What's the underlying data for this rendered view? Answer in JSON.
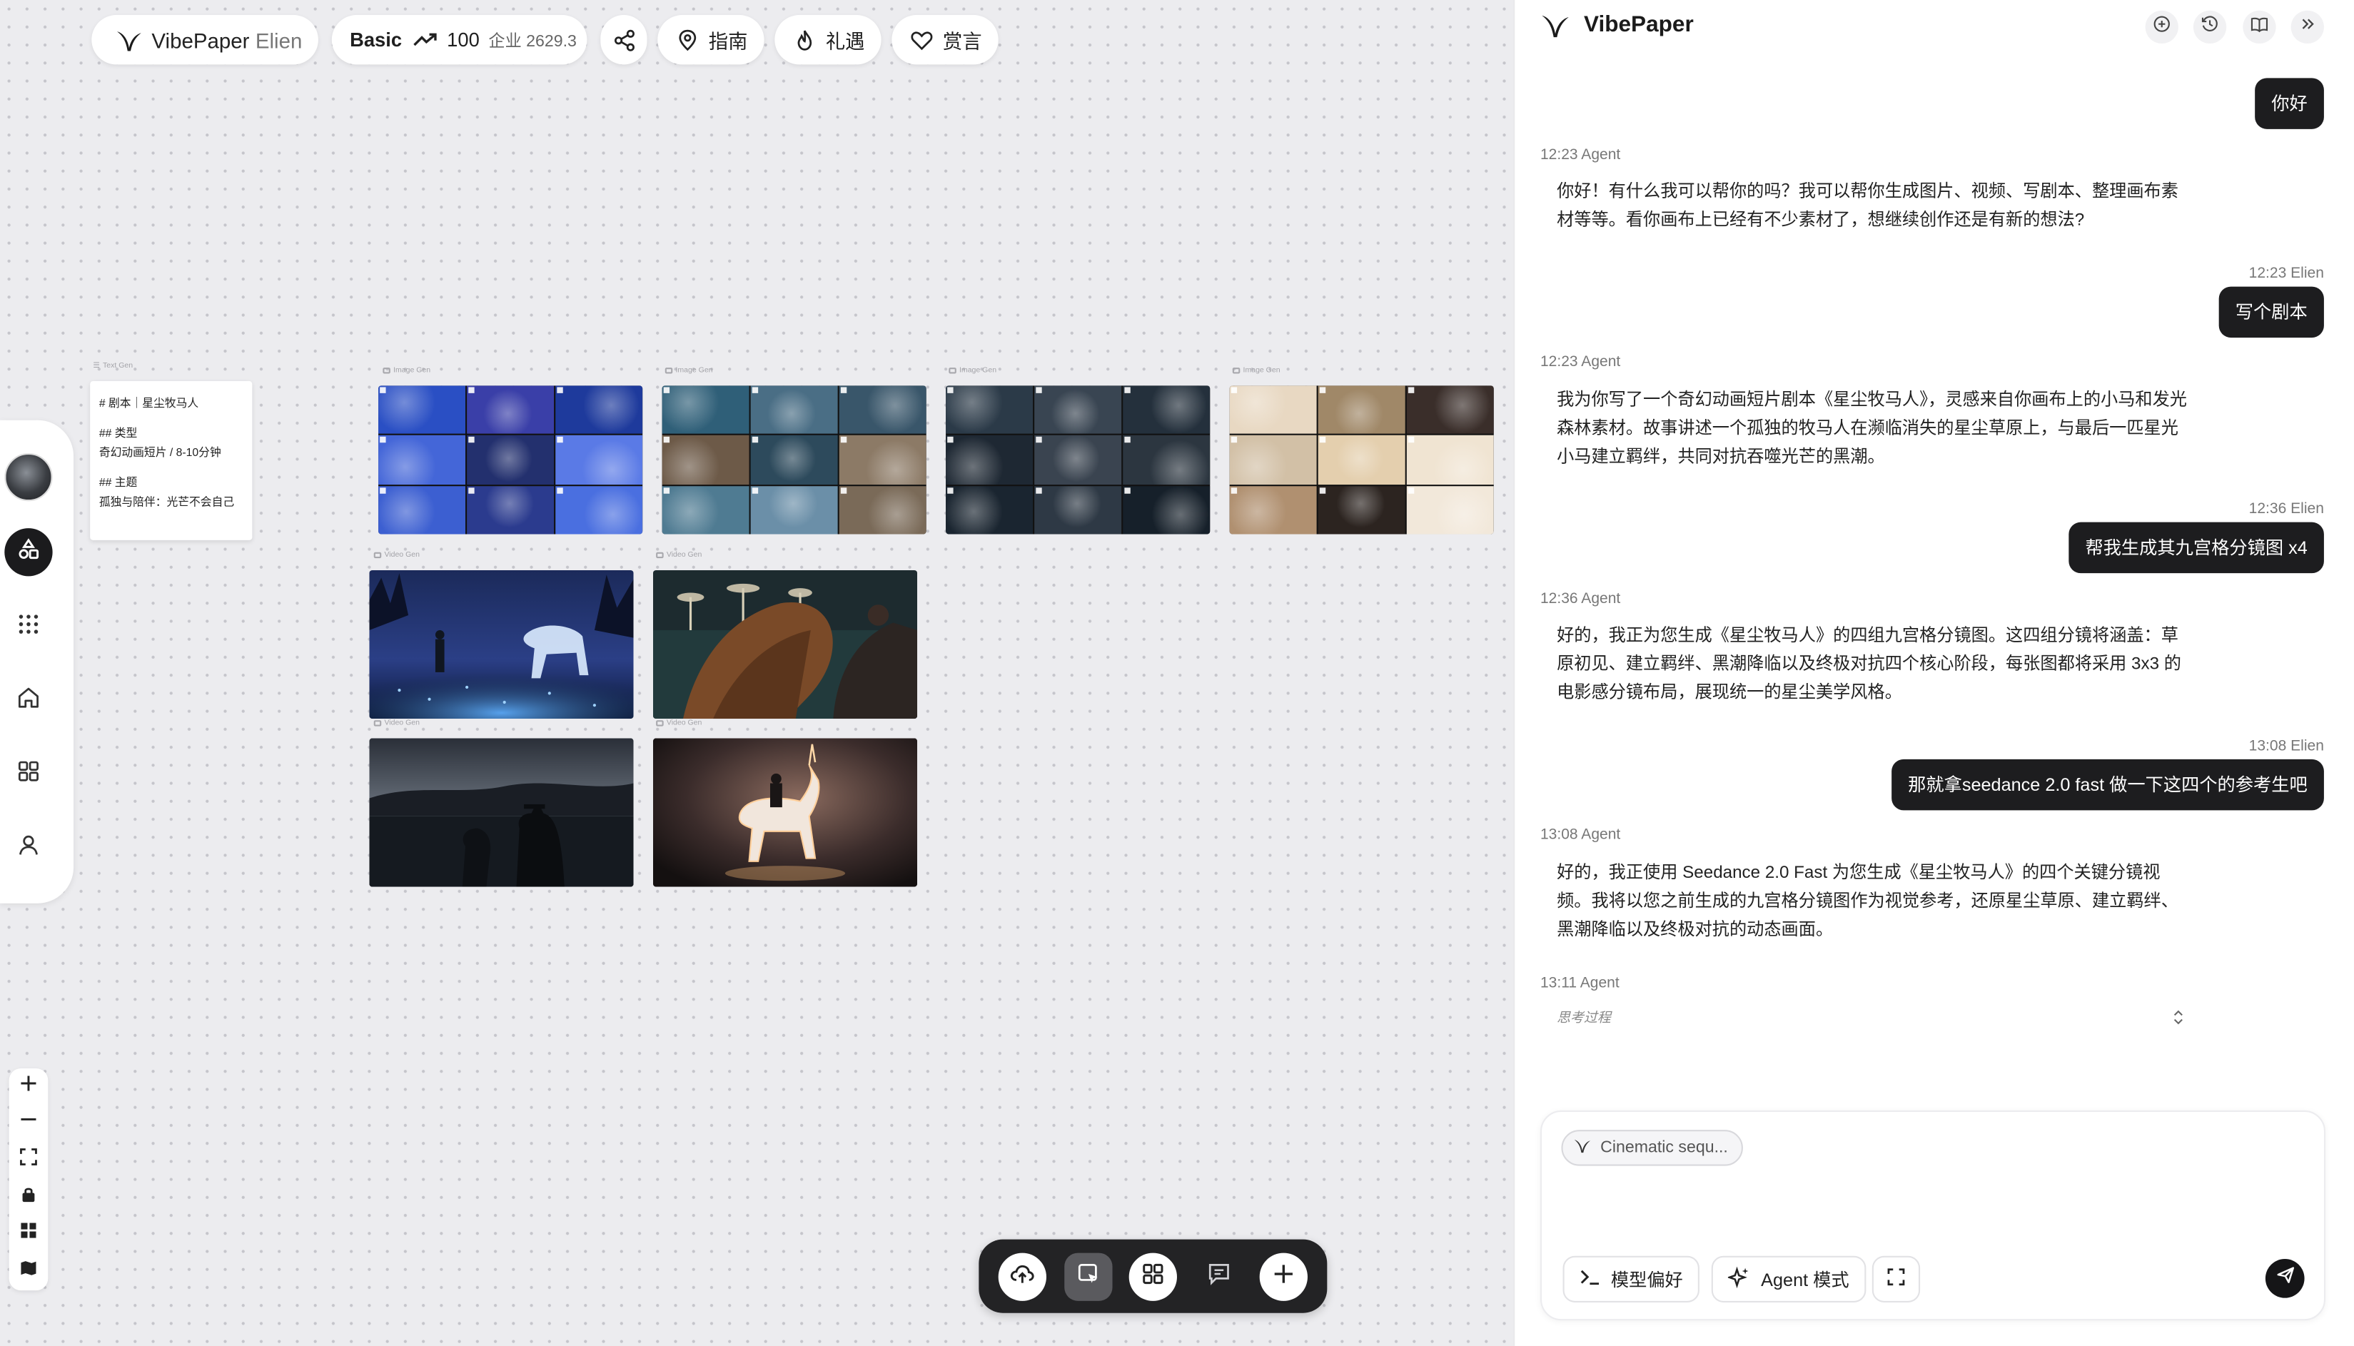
{
  "app": {
    "brand": "VibePaper",
    "user": "Elien"
  },
  "topbar": {
    "plan": "Basic",
    "credits": "100",
    "enterprise": "企业 2629.3",
    "guide": "指南",
    "gift": "礼遇",
    "tip": "赏言"
  },
  "canvas": {
    "text_node": {
      "label": "Text Gen",
      "lines": [
        "# 剧本｜星尘牧马人",
        "## 类型",
        "奇幻动画短片 / 8-10分钟",
        "## 主题",
        "孤独与陪伴：光芒不会自己"
      ]
    },
    "image_label": "Image Gen",
    "video_label": "Video Gen"
  },
  "chat": {
    "title": "VibePaper",
    "messages": [
      {
        "role": "user",
        "meta": "",
        "text": "你好"
      },
      {
        "role": "agent",
        "meta": "12:23 Agent",
        "text": "你好！有什么我可以帮你的吗？我可以帮你生成图片、视频、写剧本、整理画布素材等等。看你画布上已经有不少素材了，想继续创作还是有新的想法?"
      },
      {
        "role": "user",
        "meta": "12:23 Elien",
        "text": "写个剧本"
      },
      {
        "role": "agent",
        "meta": "12:23 Agent",
        "text": "我为你写了一个奇幻动画短片剧本《星尘牧马人》，灵感来自你画布上的小马和发光森林素材。故事讲述一个孤独的牧马人在濒临消失的星尘草原上，与最后一匹星光小马建立羁绊，共同对抗吞噬光芒的黑潮。"
      },
      {
        "role": "user",
        "meta": "12:36 Elien",
        "text": "帮我生成其九宫格分镜图 x4"
      },
      {
        "role": "agent",
        "meta": "12:36 Agent",
        "text": "好的，我正为您生成《星尘牧马人》的四组九宫格分镜图。这四组分镜将涵盖：草原初见、建立羁绊、黑潮降临以及终极对抗四个核心阶段，每张图都将采用 3x3 的电影感分镜布局，展现统一的星尘美学风格。"
      },
      {
        "role": "user",
        "meta": "13:08 Elien",
        "text": "那就拿seedance 2.0 fast 做一下这四个的参考生吧"
      },
      {
        "role": "agent",
        "meta": "13:08 Agent",
        "text": "好的，我正使用 Seedance 2.0 Fast 为您生成《星尘牧马人》的四个关键分镜视频。我将以您之前生成的九宫格分镜图作为视觉参考，还原星尘草原、建立羁绊、黑潮降临以及终极对抗的动态画面。"
      },
      {
        "role": "agent",
        "meta": "13:11 Agent",
        "text": ""
      }
    ],
    "thinking_label": "思考过程",
    "composer": {
      "chip": "Cinematic sequ...",
      "model_pref": "模型偏好",
      "agent_mode": "Agent 模式"
    }
  }
}
